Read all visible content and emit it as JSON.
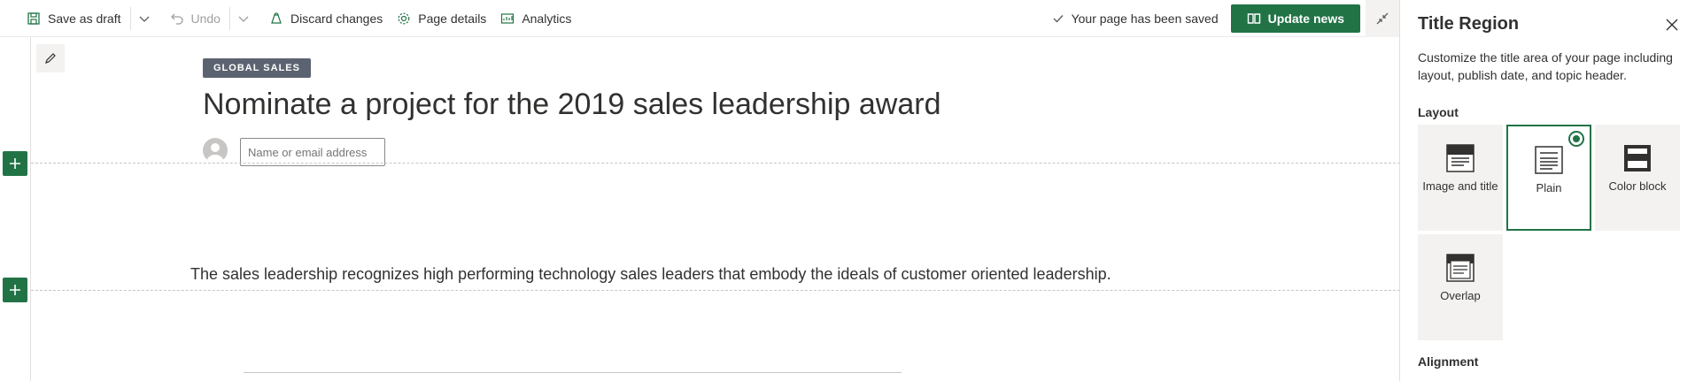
{
  "toolbar": {
    "save_draft": "Save as draft",
    "undo": "Undo",
    "discard": "Discard changes",
    "page_details": "Page details",
    "analytics": "Analytics",
    "saved_status": "Your page has been saved",
    "update_news": "Update news"
  },
  "page": {
    "topic_header": "GLOBAL SALES",
    "title": "Nominate a project for the 2019 sales leadership award",
    "author_placeholder": "Name or email address",
    "body_text": "The sales leadership recognizes high performing technology sales leaders that embody the ideals of customer oriented leadership."
  },
  "panel": {
    "title": "Title Region",
    "description": "Customize the title area of your page including layout, publish date, and topic header.",
    "layout_label": "Layout",
    "layouts": [
      {
        "label": "Image and title",
        "selected": false
      },
      {
        "label": "Plain",
        "selected": true
      },
      {
        "label": "Color block",
        "selected": false
      },
      {
        "label": "Overlap",
        "selected": false
      }
    ],
    "alignment_label": "Alignment"
  },
  "colors": {
    "accent": "#217346",
    "topic_bg": "#5c6370"
  }
}
